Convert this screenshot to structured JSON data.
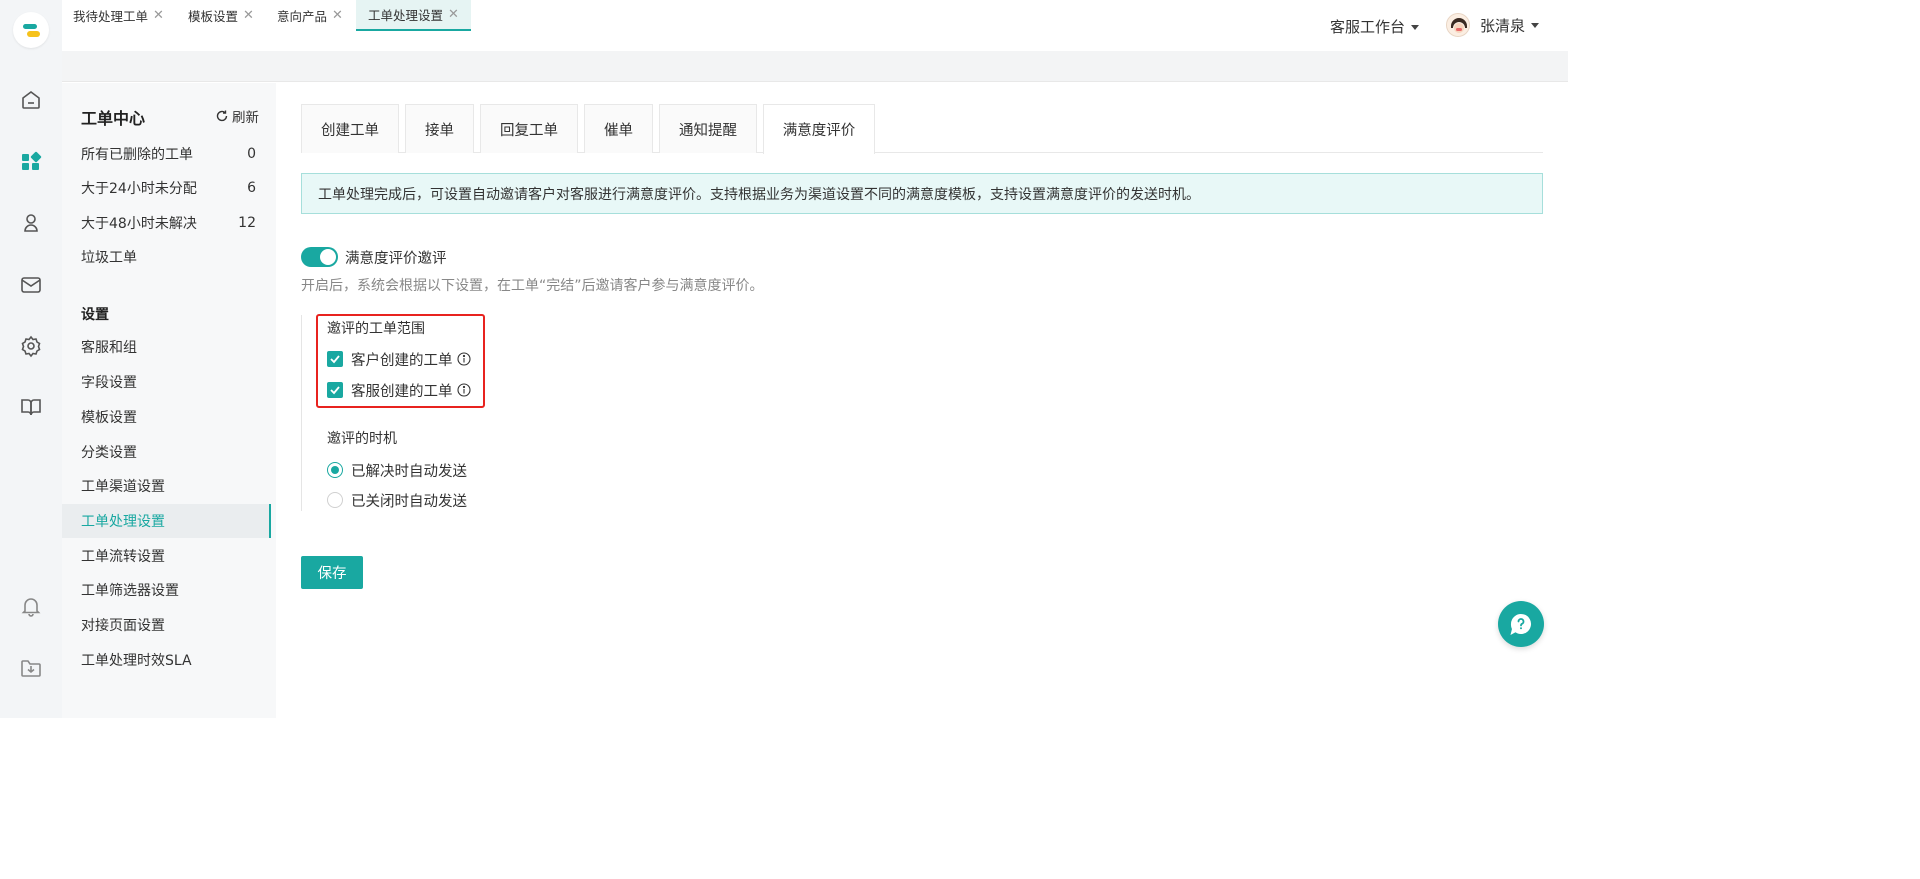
{
  "topbar": {
    "workbench_label": "客服工作台",
    "user_name": "张清泉"
  },
  "page_tabs": [
    {
      "label": "我待处理工单",
      "close": "✕"
    },
    {
      "label": "模板设置",
      "close": "✕"
    },
    {
      "label": "意向产品",
      "close": "✕"
    },
    {
      "label": "工单处理设置",
      "close": "✕"
    }
  ],
  "rail": {
    "icons": [
      "home-icon",
      "apps-icon",
      "contacts-icon",
      "mail-icon",
      "settings-icon",
      "book-icon",
      "bell-icon",
      "download-icon"
    ]
  },
  "sidebar": {
    "title": "工单中心",
    "refresh_label": "刷新",
    "items": [
      {
        "label": "所有已删除的工单",
        "count": "0"
      },
      {
        "label": "大于24小时未分配",
        "count": "6"
      },
      {
        "label": "大于48小时未解决",
        "count": "12"
      },
      {
        "label": "垃圾工单",
        "count": ""
      }
    ],
    "settings_title": "设置",
    "settings_items": [
      {
        "label": "客服和组"
      },
      {
        "label": "字段设置"
      },
      {
        "label": "模板设置"
      },
      {
        "label": "分类设置"
      },
      {
        "label": "工单渠道设置"
      },
      {
        "label": "工单处理设置"
      },
      {
        "label": "工单流转设置"
      },
      {
        "label": "工单筛选器设置"
      },
      {
        "label": "对接页面设置"
      },
      {
        "label": "工单处理时效SLA"
      }
    ],
    "active_item": "工单处理设置"
  },
  "main": {
    "tabs": [
      {
        "label": "创建工单"
      },
      {
        "label": "接单"
      },
      {
        "label": "回复工单"
      },
      {
        "label": "催单"
      },
      {
        "label": "通知提醒"
      },
      {
        "label": "满意度评价"
      }
    ],
    "active_tab": "满意度评价",
    "notice": "工单处理完成后，可设置自动邀请客户对客服进行满意度评价。支持根据业务为渠道设置不同的满意度模板，支持设置满意度评价的发送时机。",
    "toggle": {
      "label": "满意度评价邀评",
      "enabled": true
    },
    "toggle_desc": "开启后，系统会根据以下设置，在工单“完结”后邀请客户参与满意度评价。",
    "scope": {
      "title": "邀评的工单范围",
      "options": [
        {
          "label": "客户创建的工单",
          "checked": true
        },
        {
          "label": "客服创建的工单",
          "checked": true
        }
      ]
    },
    "timing": {
      "title": "邀评的时机",
      "options": [
        {
          "label": "已解决时自动发送",
          "selected": true
        },
        {
          "label": "已关闭时自动发送",
          "selected": false
        }
      ]
    },
    "save_label": "保存"
  },
  "colors": {
    "accent": "#19a8a1",
    "highlight_box": "#e8231f",
    "notice_bg": "#e8f8f7"
  }
}
